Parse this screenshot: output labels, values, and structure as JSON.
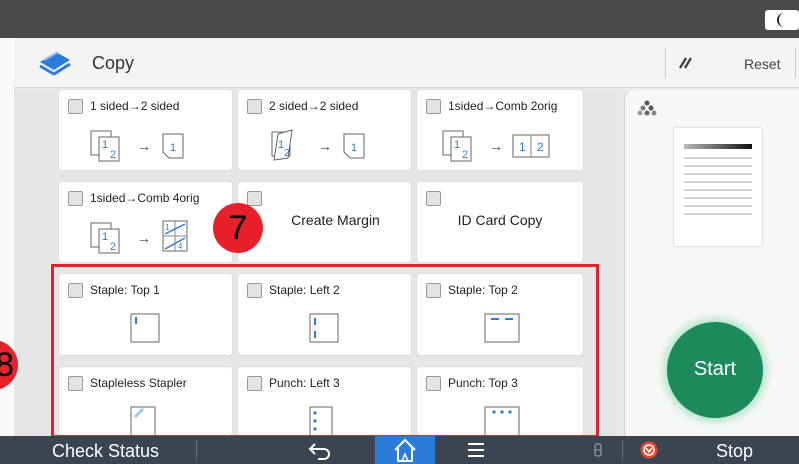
{
  "header": {
    "title": "Copy",
    "reset_label": "Reset"
  },
  "tiles": [
    {
      "label": "1 sided→2 sided"
    },
    {
      "label": "2 sided→2 sided"
    },
    {
      "label": "1sided→Comb 2orig"
    },
    {
      "label": "1sided→Comb 4orig"
    },
    {
      "label": "Create Margin"
    },
    {
      "label": "ID Card Copy"
    },
    {
      "label": "Staple: Top 1"
    },
    {
      "label": "Staple: Left 2"
    },
    {
      "label": "Staple: Top 2"
    },
    {
      "label": "Stapleless Stapler"
    },
    {
      "label": "Punch: Left 3"
    },
    {
      "label": "Punch: Top 3"
    }
  ],
  "callouts": {
    "a": "7",
    "b": "8"
  },
  "start_label": "Start",
  "bottom": {
    "check_status": "Check Status",
    "stop": "Stop"
  },
  "icons": {
    "app": "copy-icon",
    "reset": "reset-icon",
    "moon": "moon-icon",
    "preview_settings": "color-dots-icon",
    "back": "back-arrow-icon",
    "home": "home-icon",
    "menu": "menu-icon",
    "stop": "stop-icon"
  },
  "colors": {
    "accent_blue": "#2b7bd9",
    "start_green": "#1c8a5c",
    "highlight_red": "#e8202a",
    "bar_dark": "#3d4451"
  }
}
